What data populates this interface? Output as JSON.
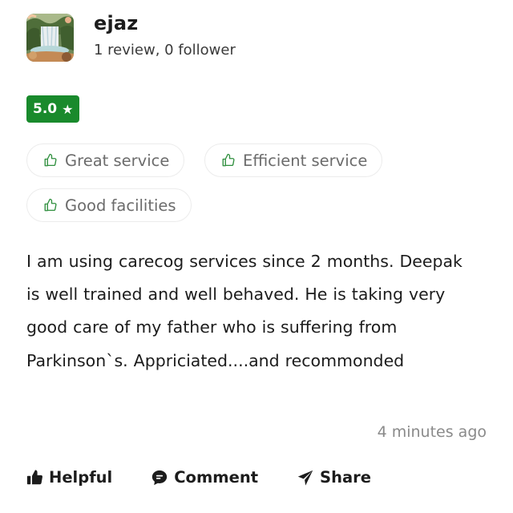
{
  "reviewer": {
    "name": "ejaz",
    "stats": "1 review, 0 follower",
    "avatar_icon": "waterfall-photo"
  },
  "rating": {
    "value": "5.0",
    "star": "★",
    "color": "#198a2c"
  },
  "tags": [
    {
      "label": "Great service",
      "icon": "thumbs-up-outline-icon"
    },
    {
      "label": "Efficient service",
      "icon": "thumbs-up-outline-icon"
    },
    {
      "label": "Good facilities",
      "icon": "thumbs-up-outline-icon"
    }
  ],
  "review": {
    "text": "I am using carecog services since 2 months. Deepak is well trained and well behaved. He is taking very good care of my father who is suffering from Parkinson`s. Appriciated....and recommonded",
    "time": "4 minutes ago"
  },
  "actions": {
    "helpful": "Helpful",
    "comment": "Comment",
    "share": "Share"
  }
}
